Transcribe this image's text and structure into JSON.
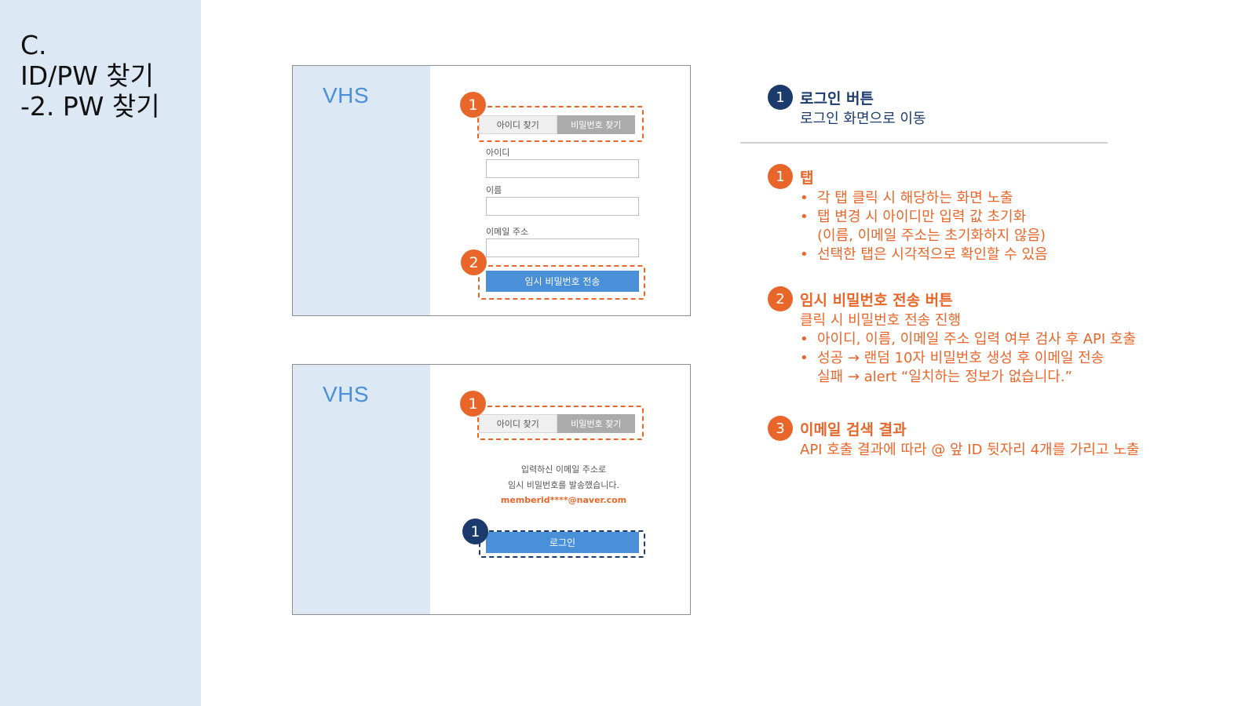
{
  "slide": {
    "title_lines": [
      "C.",
      "ID/PW 찾기",
      "-2. PW 찾기"
    ]
  },
  "mock1": {
    "logo": "VHS",
    "tabs": {
      "find_id": "아이디 찾기",
      "find_pw": "비밀번호 찾기"
    },
    "fields": {
      "id_label": "아이디",
      "name_label": "이름",
      "email_label": "이메일 주소"
    },
    "send_button": "임시 비밀번호 전송",
    "badges": {
      "tabs": "1",
      "send": "2"
    }
  },
  "mock2": {
    "logo": "VHS",
    "tabs": {
      "find_id": "아이디 찾기",
      "find_pw": "비밀번호 찾기"
    },
    "message_line1": "입력하신 이메일 주소로",
    "message_line2": "임시 비밀번호를 발송했습니다.",
    "email": "memberid****@naver.com",
    "login_button": "로그인",
    "badges": {
      "tabs": "1",
      "login": "1"
    }
  },
  "annotations": {
    "login": {
      "num": "1",
      "title": "로그인 버튼",
      "desc": "로그인 화면으로 이동"
    },
    "tab": {
      "num": "1",
      "title": "탭",
      "bullets": [
        "각 탭 클릭 시 해당하는 화면 노출",
        "탭 변경 시 아이디만 입력 값 초기화"
      ],
      "bullet2_cont": "(이름, 이메일 주소는 초기화하지 않음)",
      "bullet3": "선택한 탭은 시각적으로 확인할 수 있음"
    },
    "send": {
      "num": "2",
      "title": "임시 비밀번호 전송 버튼",
      "desc": "클릭 시 비밀번호 전송 진행",
      "bullet1": "아이디, 이름, 이메일 주소 입력 여부 검사 후 API 호출",
      "bullet2": "성공 → 랜덤 10자 비밀번호 생성 후 이메일 전송",
      "bullet2_cont": "실패 → alert “일치하는 정보가 없습니다.”"
    },
    "email_result": {
      "num": "3",
      "title": "이메일 검색 결과",
      "desc": "API 호출 결과에 따라 @ 앞 ID 뒷자리 4개를 가리고 노출"
    }
  },
  "colors": {
    "accent_orange": "#e8662a",
    "navy": "#1a3b6b",
    "button_blue": "#4a90d9",
    "panel_blue": "#dde8f5"
  }
}
